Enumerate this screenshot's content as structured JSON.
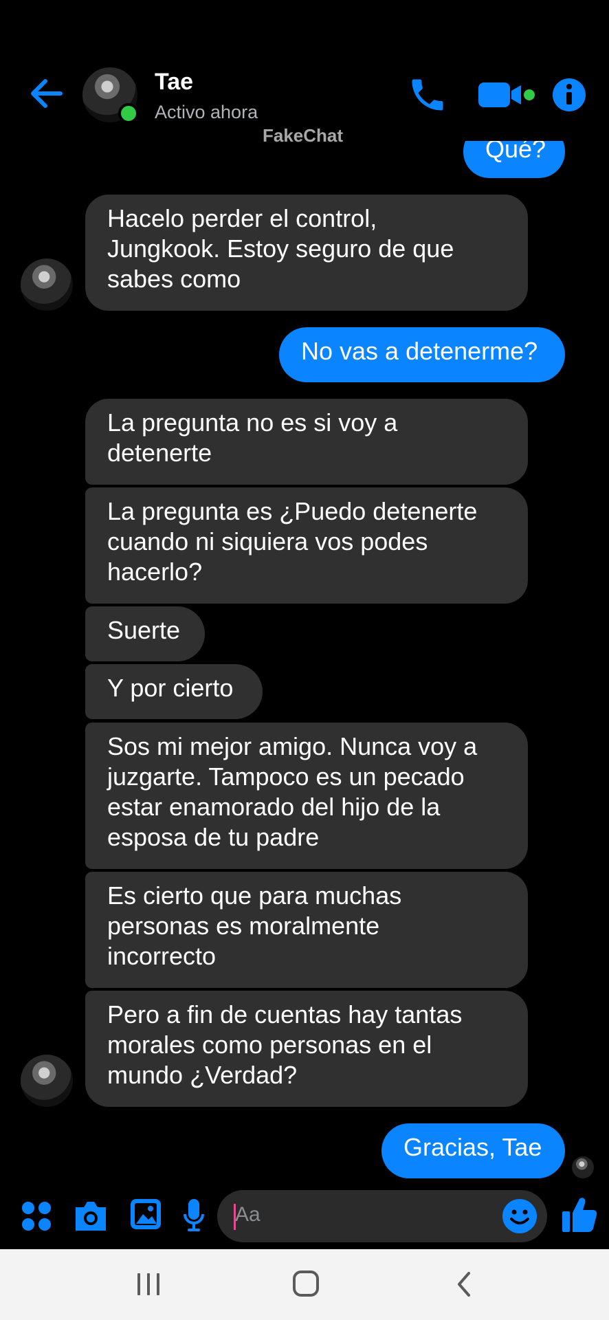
{
  "header": {
    "contact_name": "Tae",
    "status": "Activo ahora",
    "watermark": "FakeChat"
  },
  "messages": [
    {
      "side": "out",
      "lines": [
        "Qué?"
      ]
    },
    {
      "side": "in",
      "lines": [
        "Hacelo perder el control,",
        "Jungkook. Estoy seguro de que",
        "sabes como"
      ]
    },
    {
      "side": "out",
      "lines": [
        "No vas a detenerme?"
      ]
    },
    {
      "side": "in",
      "lines": [
        "La pregunta no es si voy a",
        "detenerte"
      ]
    },
    {
      "side": "in",
      "lines": [
        "La pregunta es ¿Puedo detenerte",
        "cuando ni siquiera vos podes",
        "hacerlo?"
      ]
    },
    {
      "side": "in",
      "lines": [
        "Suerte"
      ]
    },
    {
      "side": "in",
      "lines": [
        "Y por cierto"
      ]
    },
    {
      "side": "in",
      "lines": [
        "Sos mi mejor amigo. Nunca voy a",
        "juzgarte. Tampoco es un pecado",
        "estar enamorado del hijo de la",
        "esposa de tu padre"
      ]
    },
    {
      "side": "in",
      "lines": [
        "Es cierto que para muchas",
        "personas es moralmente",
        "incorrecto"
      ]
    },
    {
      "side": "in",
      "lines": [
        "Pero a fin de cuentas hay tantas",
        "morales como personas en el",
        "mundo ¿Verdad?"
      ]
    },
    {
      "side": "out",
      "lines": [
        "Gracias, Tae"
      ]
    }
  ],
  "composer": {
    "placeholder": "Aa"
  },
  "colors": {
    "accent": "#0a84ff",
    "incoming_bubble": "#303030",
    "online": "#31cc46",
    "background": "#000000"
  },
  "icons": [
    "back-arrow-icon",
    "phone-icon",
    "video-call-icon",
    "info-icon",
    "apps-grid-icon",
    "camera-icon",
    "gallery-icon",
    "microphone-icon",
    "emoji-icon",
    "thumbs-up-icon",
    "recents-icon",
    "home-icon",
    "nav-back-icon"
  ]
}
